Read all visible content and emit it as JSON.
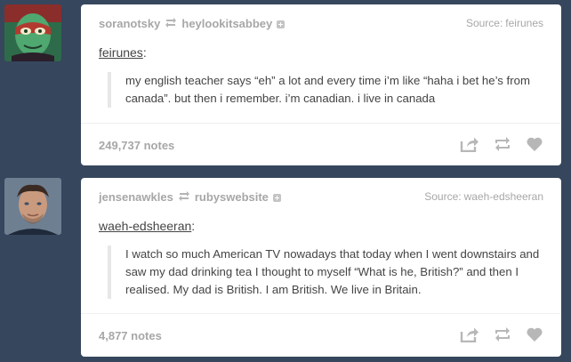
{
  "posts": [
    {
      "reblogger": "soranotsky",
      "reblogged_from": "heylookitsabbey",
      "source_label": "Source:",
      "source_name": "feirunes",
      "original_poster": "feirunes",
      "poster_colon": ":",
      "quote": "my english teacher says “eh” a lot and every time i’m like “haha i bet he’s from canada”. but then i remember. i’m canadian. i live in canada",
      "notes": "249,737 notes",
      "avatar_icon": "masked-character-avatar"
    },
    {
      "reblogger": "jensenawkles",
      "reblogged_from": "rubyswebsite",
      "source_label": "Source:",
      "source_name": "waeh-edsheeran",
      "original_poster": "waeh-edsheeran",
      "poster_colon": ":",
      "quote": "I watch so much American TV nowadays that today when I went downstairs and saw my dad drinking tea I thought to myself “What is he, British?” and then I realised. My dad is British. I am British. We live in Britain.",
      "notes": "4,877 notes",
      "avatar_icon": "man-portrait-avatar"
    }
  ],
  "icons": [
    "share-icon",
    "reblog-icon",
    "like-icon"
  ],
  "colors": {
    "background": "#36465d",
    "card": "#ffffff",
    "muted_text": "#a7a7a7",
    "body_text": "#444444",
    "quote_border": "#e7e7e7"
  }
}
